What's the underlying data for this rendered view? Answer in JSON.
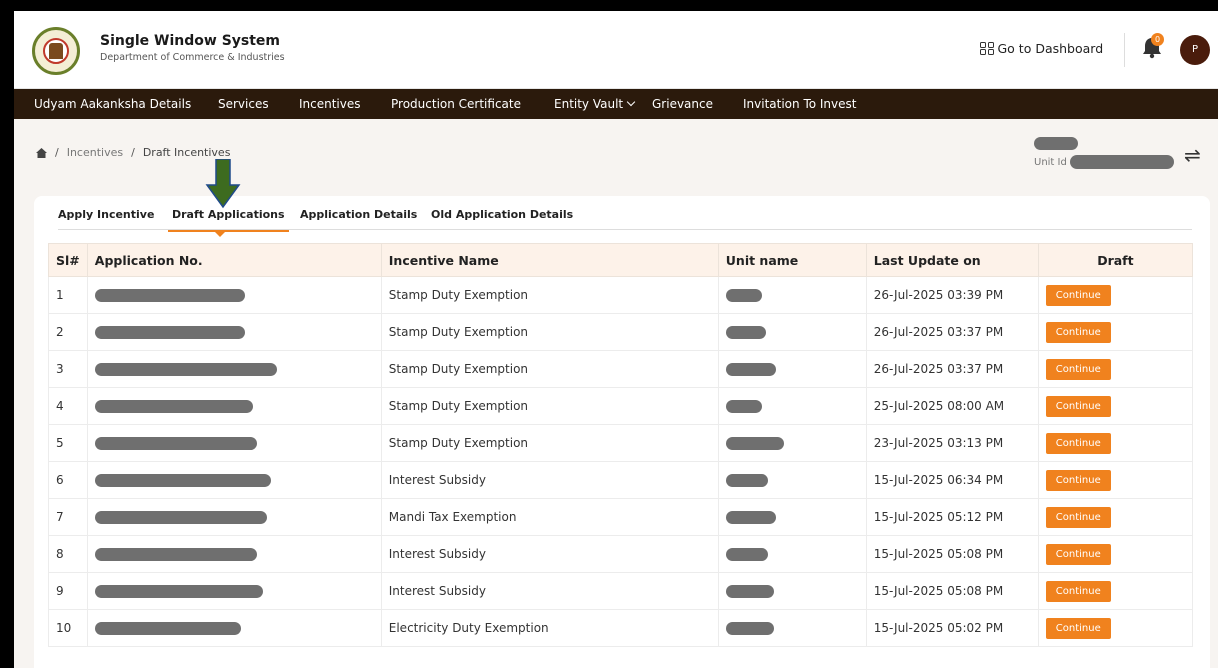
{
  "header": {
    "title": "Single Window System",
    "subtitle": "Department of Commerce & Industries",
    "dashboard_label": "Go to Dashboard",
    "notification_count": "0",
    "avatar_initial": "P"
  },
  "nav": {
    "items": [
      "Udyam Aakanksha Details",
      "Services",
      "Incentives",
      "Production Certificate",
      "Entity Vault",
      "Grievance",
      "Invitation To Invest"
    ]
  },
  "breadcrumb": {
    "home_icon": "home-icon",
    "items": [
      "Incentives",
      "Draft Incentives"
    ],
    "separator": "/"
  },
  "unit": {
    "label": "Unit Id"
  },
  "tabs": [
    "Apply Incentive",
    "Draft Applications",
    "Application Details",
    "Old Application Details"
  ],
  "active_tab": "Draft Applications",
  "table": {
    "headers": [
      "Sl#",
      "Application No.",
      "Incentive Name",
      "Unit name",
      "Last Update on",
      "Draft"
    ],
    "rows": [
      {
        "sl": "1",
        "incentive": "Stamp Duty Exemption",
        "updated": "26-Jul-2025 03:39 PM",
        "action": "Continue"
      },
      {
        "sl": "2",
        "incentive": "Stamp Duty Exemption",
        "updated": "26-Jul-2025 03:37 PM",
        "action": "Continue"
      },
      {
        "sl": "3",
        "incentive": "Stamp Duty Exemption",
        "updated": "26-Jul-2025 03:37 PM",
        "action": "Continue"
      },
      {
        "sl": "4",
        "incentive": "Stamp Duty Exemption",
        "updated": "25-Jul-2025 08:00 AM",
        "action": "Continue"
      },
      {
        "sl": "5",
        "incentive": "Stamp Duty Exemption",
        "updated": "23-Jul-2025 03:13 PM",
        "action": "Continue"
      },
      {
        "sl": "6",
        "incentive": "Interest Subsidy",
        "updated": "15-Jul-2025 06:34 PM",
        "action": "Continue"
      },
      {
        "sl": "7",
        "incentive": "Mandi Tax Exemption",
        "updated": "15-Jul-2025 05:12 PM",
        "action": "Continue"
      },
      {
        "sl": "8",
        "incentive": "Interest Subsidy",
        "updated": "15-Jul-2025 05:08 PM",
        "action": "Continue"
      },
      {
        "sl": "9",
        "incentive": "Interest Subsidy",
        "updated": "15-Jul-2025 05:08 PM",
        "action": "Continue"
      },
      {
        "sl": "10",
        "incentive": "Electricity Duty Exemption",
        "updated": "15-Jul-2025 05:02 PM",
        "action": "Continue"
      }
    ]
  },
  "colors": {
    "accent": "#f0821e",
    "nav_bg": "#2b1a0c",
    "header_row_bg": "#fdf2e9",
    "annotation_arrow": "#3d6b1f"
  }
}
